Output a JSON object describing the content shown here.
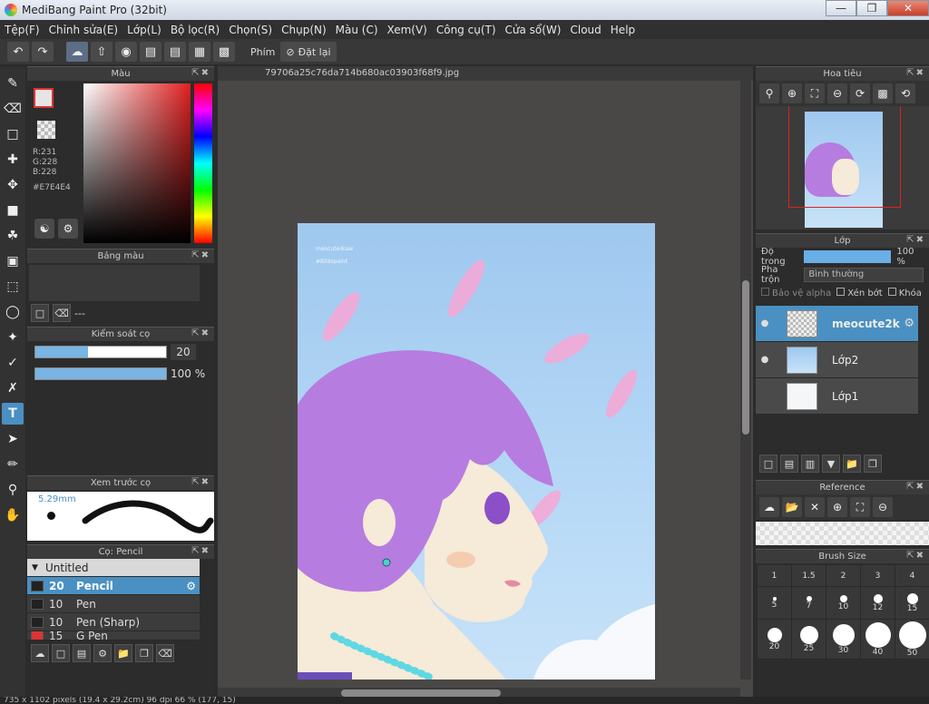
{
  "window": {
    "title": "MediBang Paint Pro (32bit)"
  },
  "menu": [
    "Tệp(F)",
    "Chỉnh sửa(E)",
    "Lớp(L)",
    "Bộ lọc(R)",
    "Chọn(S)",
    "Chụp(N)",
    "Màu (C)",
    "Xem(V)",
    "Công cụ(T)",
    "Cửa sổ(W)",
    "Cloud",
    "Help"
  ],
  "toolbar": {
    "stroke_label": "Phím",
    "reset_label": "Đặt lại"
  },
  "panels": {
    "color": {
      "title": "Màu",
      "r": "R:231",
      "g": "G:228",
      "b": "B:228",
      "hex": "#E7E4E4",
      "fg_color": "#E7E4E4"
    },
    "palette": {
      "title": "Bảng màu",
      "empty": "---"
    },
    "brush_control": {
      "title": "Kiểm soát cọ",
      "size": "20",
      "opacity": "100 %",
      "size_fill": 0.4,
      "opacity_fill": 1.0
    },
    "brush_preview": {
      "title": "Xem trước cọ",
      "size_label": "5.29mm"
    },
    "brush_list": {
      "title": "Cọ: Pencil",
      "group": "Untitled",
      "items": [
        {
          "size": "20",
          "name": "Pencil",
          "selected": true
        },
        {
          "size": "10",
          "name": "Pen",
          "selected": false
        },
        {
          "size": "10",
          "name": "Pen (Sharp)",
          "selected": false
        },
        {
          "size": "15",
          "name": "G Pen",
          "selected": false
        }
      ]
    },
    "navigator": {
      "title": "Hoa tiêu"
    },
    "layers": {
      "title": "Lớp",
      "opacity_label": "Độ trong",
      "opacity_value": "100 %",
      "blend_label": "Pha trộn",
      "blend_value": "Bình thường",
      "protect_alpha": "Bảo vệ alpha",
      "clipping": "Xén bớt",
      "lock": "Khóa",
      "items": [
        {
          "name": "meocute2k",
          "selected": true
        },
        {
          "name": "Lớp2",
          "selected": false
        },
        {
          "name": "Lớp1",
          "selected": false
        }
      ]
    },
    "reference": {
      "title": "Reference"
    },
    "brush_size": {
      "title": "Brush Size",
      "sizes": [
        "1",
        "1.5",
        "2",
        "3",
        "4",
        "5",
        "7",
        "10",
        "12",
        "15",
        "20",
        "25",
        "30",
        "40",
        "50"
      ]
    }
  },
  "document": {
    "tab": "79706a25c76da714b680ac03903f68f9.jpg"
  },
  "status": {
    "text": "735 x 1102 pixels (19.4 x 29.2cm) 96 dpi 66 % (177, 15)"
  },
  "art": {
    "watermark_line1": "meocutedraw",
    "watermark_line2": "#Bilibipaint"
  }
}
